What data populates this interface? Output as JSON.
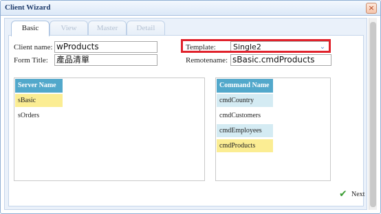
{
  "window": {
    "title": "Client Wizard",
    "close_glyph": "×"
  },
  "tabs": [
    {
      "label": "Basic",
      "active": true
    },
    {
      "label": "View",
      "active": false
    },
    {
      "label": "Master",
      "active": false
    },
    {
      "label": "Detail",
      "active": false
    }
  ],
  "form": {
    "client_name_label": "Client name:",
    "client_name_value": "wProducts",
    "form_title_label": "Form Title:",
    "form_title_value": "產品清單",
    "template_label": "Template:",
    "template_value": "Single2",
    "remotename_label": "Remotename:",
    "remotename_value": "sBasic.cmdProducts"
  },
  "server_list": {
    "header": "Server Name —",
    "items": [
      {
        "label": "sBasic",
        "selected": true
      },
      {
        "label": "sOrders",
        "selected": false
      }
    ]
  },
  "command_list": {
    "header": "Command Name —",
    "items": [
      {
        "label": "cmdCountry",
        "state": "alt"
      },
      {
        "label": "cmdCustomers",
        "state": "normal"
      },
      {
        "label": "cmdEmployees",
        "state": "alt"
      },
      {
        "label": "cmdProducts",
        "state": "selected"
      }
    ]
  },
  "footer": {
    "next_label": "Next"
  },
  "colors": {
    "accent_header": "#52a8cb",
    "selected_row": "#fbed93",
    "alt_row": "#d4ebf3",
    "highlight_border": "#e0212b",
    "next_icon": "#3a9c33"
  },
  "icons": {
    "close": "close-icon",
    "dropdown": "chevron-down-icon",
    "next": "checkmark-icon"
  }
}
